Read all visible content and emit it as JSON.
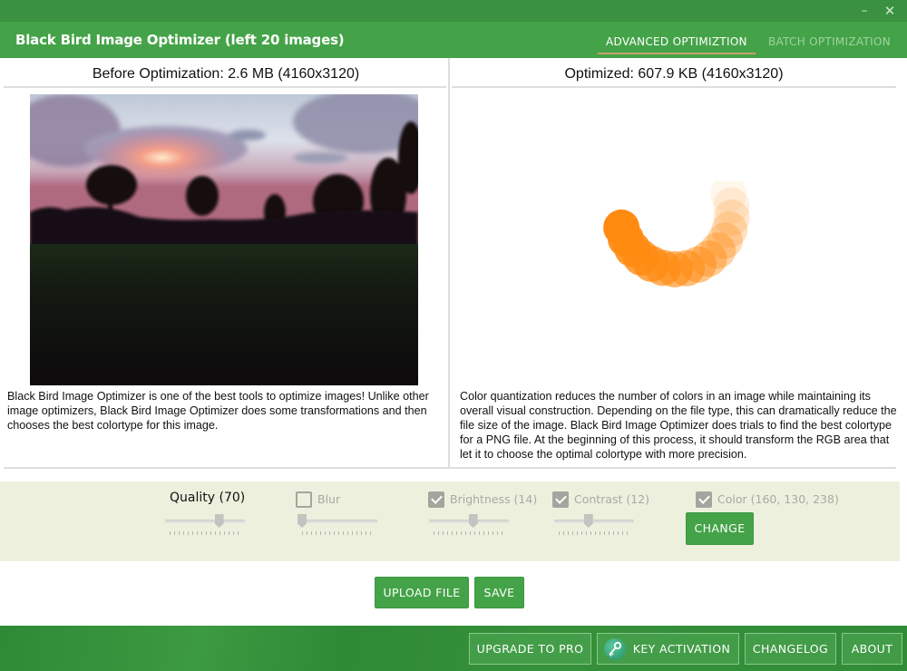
{
  "window": {
    "minimize_icon": "minimize-icon",
    "close_icon": "close-icon",
    "minimize_glyph": "–",
    "close_glyph": "✕"
  },
  "header": {
    "title": "Black Bird Image Optimizer (left 20 images)",
    "tabs": [
      {
        "label": "ADVANCED OPTIMIZTION",
        "active": true
      },
      {
        "label": "BATCH OPTIMIZATION",
        "active": false
      }
    ]
  },
  "before": {
    "heading": "Before Optimization: 2.6 MB (4160x3120)",
    "description": "Black Bird Image Optimizer is one of the best tools to optimize images! Unlike other image optimizers, Black Bird Image Optimizer does some transformations and then chooses the best colortype for this image."
  },
  "after": {
    "heading": "Optimized: 607.9 KB (4160x3120)",
    "description": "Color quantization reduces the number of colors in an image while maintaining its overall visual construction. Depending on the file type, this can dramatically reduce the file size of the image. Black Bird Image Optimizer does trials to find the best colortype for a PNG file. At the beginning of this process, it should transform the RGB area that let it to choose the optimal colortype with more precision.",
    "spinner_color": "#ff8a10"
  },
  "settings": {
    "quality": {
      "label": "Quality (70)",
      "value_fraction": 0.7
    },
    "blur": {
      "label": "Blur",
      "checked": false,
      "value_fraction": 0.0
    },
    "brightness": {
      "label": "Brightness (14)",
      "checked": true,
      "value_fraction": 0.56
    },
    "contrast": {
      "label": "Contrast (12)",
      "checked": true,
      "value_fraction": 0.42
    },
    "color": {
      "label": "Color (160, 130, 238)",
      "checked": true
    },
    "change_label": "CHANGE"
  },
  "actions": {
    "upload_label": "UPLOAD FILE",
    "save_label": "SAVE"
  },
  "footer": {
    "upgrade_label": "UPGRADE TO PRO",
    "key_label": "KEY ACTIVATION",
    "changelog_label": "CHANGELOG",
    "about_label": "ABOUT"
  },
  "colors": {
    "brand_green": "#44a348",
    "titlebar_green": "#3a9240",
    "settings_bg": "#eef0de",
    "tab_underline": "#c9a066"
  }
}
